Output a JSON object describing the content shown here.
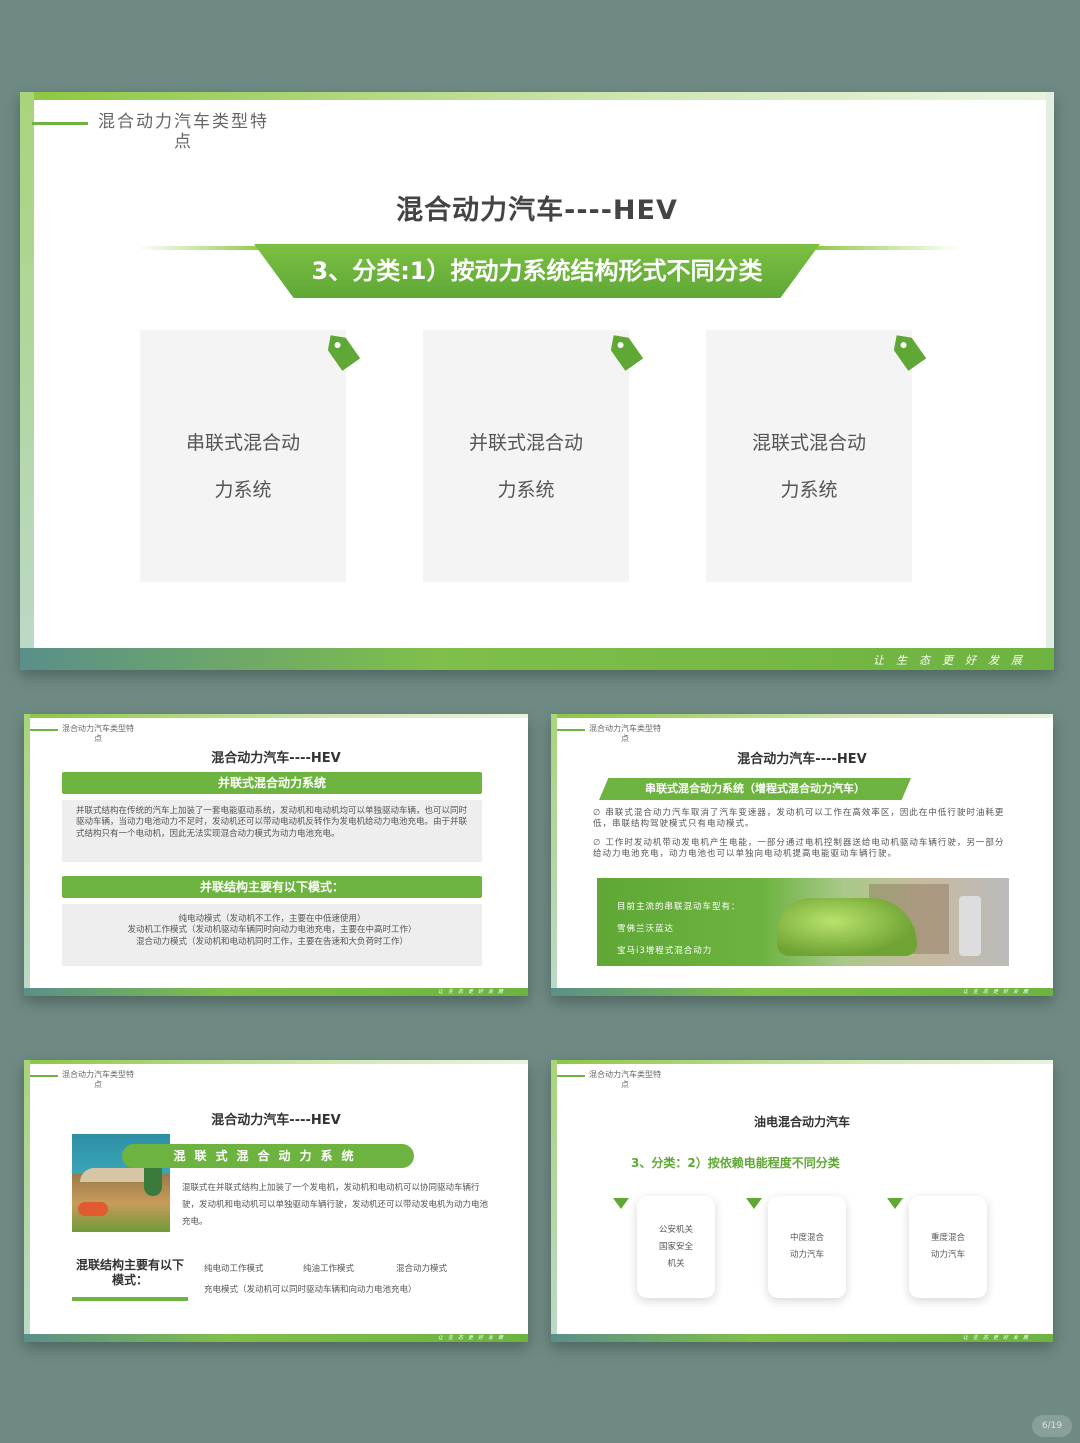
{
  "header": {
    "line1": "混合动力汽车类型特",
    "line2": "点"
  },
  "footer_slogan": "让生态更好发展",
  "hev_title": "混合动力汽车----HEV",
  "slide1": {
    "banner": "3、分类:1）按动力系统结构形式不同分类",
    "cards": [
      {
        "line1": "串联式混合动",
        "line2": "力系统"
      },
      {
        "line1": "并联式混合动",
        "line2": "力系统"
      },
      {
        "line1": "混联式混合动",
        "line2": "力系统"
      }
    ]
  },
  "slide2": {
    "bar1": "并联式混合动力系统",
    "box1": "并联式结构在传统的汽车上加装了一套电能驱动系统，发动机和电动机均可以单独驱动车辆，也可以同时驱动车辆，当动力电池动力不足时，发动机还可以带动电动机反转作为发电机给动力电池充电。由于并联式结构只有一个电动机，因此无法实现混合动力模式为动力电池充电。",
    "bar2": "并联结构主要有以下模式：",
    "modes": [
      "纯电动模式（发动机不工作，主要在中低速使用）",
      "发动机工作模式（发动机驱动车辆同时向动力电池充电，主要在中高时工作）",
      "混合动力模式（发动机和电动机同时工作，主要在告速和大负荷时工作）"
    ]
  },
  "slide3": {
    "banner": "串联式混合动力系统（增程式混合动力汽车）",
    "bullets": [
      {
        "sym": "∅",
        "text": "串联式混合动力汽车取消了汽车变速器，发动机可以工作在高效率区，因此在中低行驶时油耗更低，串联结构驾驶模式只有电动模式。"
      },
      {
        "sym": "∅",
        "text": "工作时发动机带动发电机产生电能，一部分通过电机控制器送给电动机驱动车辆行驶，另一部分给动力电池充电，动力电池也可以单独向电动机提高电能驱动车辆行驶。"
      }
    ],
    "photo_lines": [
      "目前主流的串联混动车型有：",
      "雪佛兰沃蓝达",
      "宝马i3增程式混合动力"
    ]
  },
  "slide4": {
    "pill": "混联式混合动力系统",
    "desc": "混联式在并联式结构上加装了一个发电机，发动机和电动机可以协同驱动车辆行驶，发动机和电动机可以单独驱动车辆行驶，发动机还可以带动发电机为动力电池充电。",
    "left_label": "混联结构主要有以下模式：",
    "modes_row": [
      "纯电动工作模式",
      "纯油工作模式",
      "混合动力模式"
    ],
    "mode_full": "充电模式（发动机可以同时驱动车辆和向动力电池充电）"
  },
  "slide5": {
    "title": "油电混合动力汽车",
    "subtitle": "3、分类：2）按依赖电能程度不同分类",
    "boxes": [
      {
        "lines": [
          "公安机关",
          "国家安全",
          "机关"
        ]
      },
      {
        "lines": [
          "中度混合",
          "动力汽车"
        ]
      },
      {
        "lines": [
          "重度混合",
          "动力汽车"
        ]
      }
    ]
  },
  "watermark": "6/19"
}
